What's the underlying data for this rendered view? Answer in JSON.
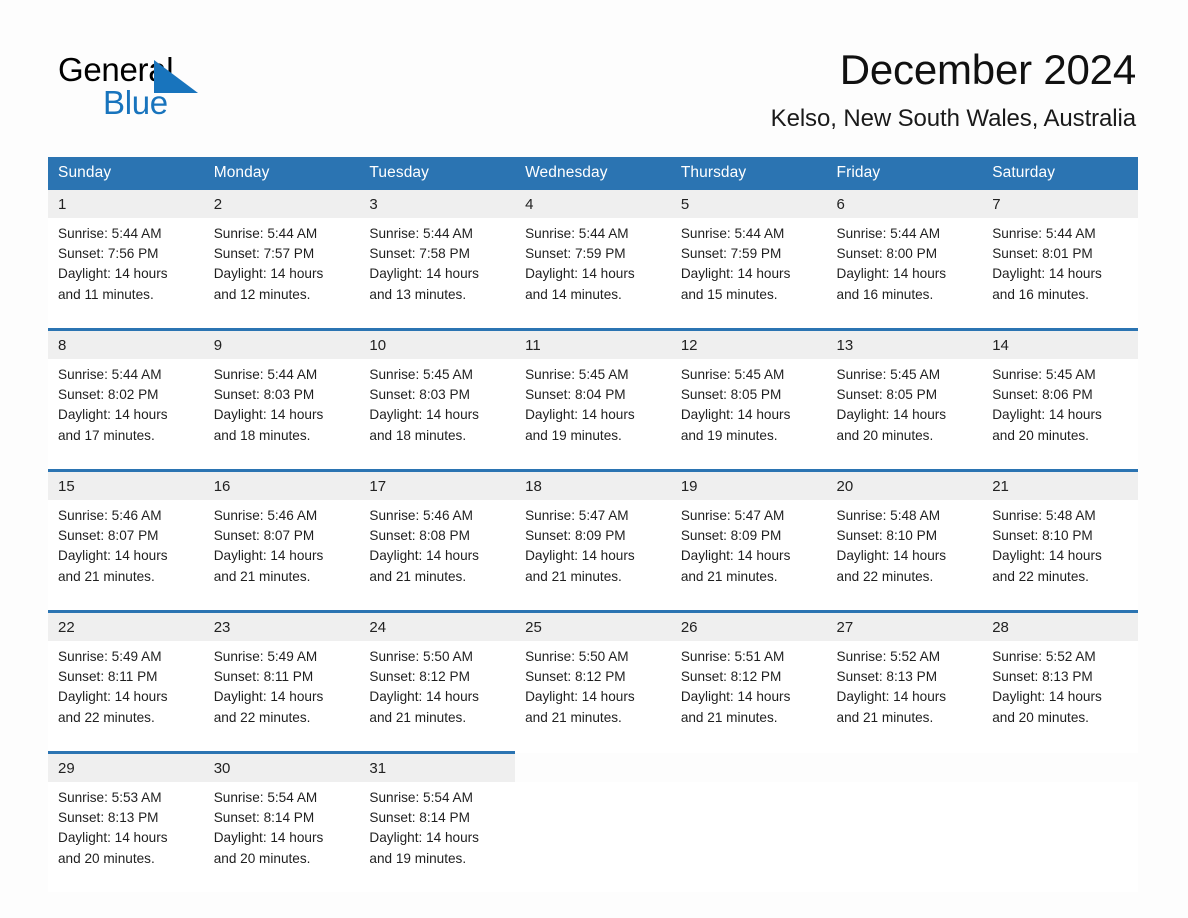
{
  "brand": {
    "name_part1": "General",
    "name_part2": "Blue",
    "triangle_color": "#1874bd"
  },
  "header": {
    "month_title": "December 2024",
    "location": "Kelso, New South Wales, Australia"
  },
  "theme": {
    "header_blue": "#2b74b2",
    "date_band_gray": "#efefef",
    "page_background": "#fdfdfd"
  },
  "weekday_headers": [
    "Sunday",
    "Monday",
    "Tuesday",
    "Wednesday",
    "Thursday",
    "Friday",
    "Saturday"
  ],
  "weeks": [
    {
      "days": [
        {
          "date": "1",
          "sunrise": "Sunrise: 5:44 AM",
          "sunset": "Sunset: 7:56 PM",
          "daylight_line1": "Daylight: 14 hours",
          "daylight_line2": "and 11 minutes."
        },
        {
          "date": "2",
          "sunrise": "Sunrise: 5:44 AM",
          "sunset": "Sunset: 7:57 PM",
          "daylight_line1": "Daylight: 14 hours",
          "daylight_line2": "and 12 minutes."
        },
        {
          "date": "3",
          "sunrise": "Sunrise: 5:44 AM",
          "sunset": "Sunset: 7:58 PM",
          "daylight_line1": "Daylight: 14 hours",
          "daylight_line2": "and 13 minutes."
        },
        {
          "date": "4",
          "sunrise": "Sunrise: 5:44 AM",
          "sunset": "Sunset: 7:59 PM",
          "daylight_line1": "Daylight: 14 hours",
          "daylight_line2": "and 14 minutes."
        },
        {
          "date": "5",
          "sunrise": "Sunrise: 5:44 AM",
          "sunset": "Sunset: 7:59 PM",
          "daylight_line1": "Daylight: 14 hours",
          "daylight_line2": "and 15 minutes."
        },
        {
          "date": "6",
          "sunrise": "Sunrise: 5:44 AM",
          "sunset": "Sunset: 8:00 PM",
          "daylight_line1": "Daylight: 14 hours",
          "daylight_line2": "and 16 minutes."
        },
        {
          "date": "7",
          "sunrise": "Sunrise: 5:44 AM",
          "sunset": "Sunset: 8:01 PM",
          "daylight_line1": "Daylight: 14 hours",
          "daylight_line2": "and 16 minutes."
        }
      ]
    },
    {
      "days": [
        {
          "date": "8",
          "sunrise": "Sunrise: 5:44 AM",
          "sunset": "Sunset: 8:02 PM",
          "daylight_line1": "Daylight: 14 hours",
          "daylight_line2": "and 17 minutes."
        },
        {
          "date": "9",
          "sunrise": "Sunrise: 5:44 AM",
          "sunset": "Sunset: 8:03 PM",
          "daylight_line1": "Daylight: 14 hours",
          "daylight_line2": "and 18 minutes."
        },
        {
          "date": "10",
          "sunrise": "Sunrise: 5:45 AM",
          "sunset": "Sunset: 8:03 PM",
          "daylight_line1": "Daylight: 14 hours",
          "daylight_line2": "and 18 minutes."
        },
        {
          "date": "11",
          "sunrise": "Sunrise: 5:45 AM",
          "sunset": "Sunset: 8:04 PM",
          "daylight_line1": "Daylight: 14 hours",
          "daylight_line2": "and 19 minutes."
        },
        {
          "date": "12",
          "sunrise": "Sunrise: 5:45 AM",
          "sunset": "Sunset: 8:05 PM",
          "daylight_line1": "Daylight: 14 hours",
          "daylight_line2": "and 19 minutes."
        },
        {
          "date": "13",
          "sunrise": "Sunrise: 5:45 AM",
          "sunset": "Sunset: 8:05 PM",
          "daylight_line1": "Daylight: 14 hours",
          "daylight_line2": "and 20 minutes."
        },
        {
          "date": "14",
          "sunrise": "Sunrise: 5:45 AM",
          "sunset": "Sunset: 8:06 PM",
          "daylight_line1": "Daylight: 14 hours",
          "daylight_line2": "and 20 minutes."
        }
      ]
    },
    {
      "days": [
        {
          "date": "15",
          "sunrise": "Sunrise: 5:46 AM",
          "sunset": "Sunset: 8:07 PM",
          "daylight_line1": "Daylight: 14 hours",
          "daylight_line2": "and 21 minutes."
        },
        {
          "date": "16",
          "sunrise": "Sunrise: 5:46 AM",
          "sunset": "Sunset: 8:07 PM",
          "daylight_line1": "Daylight: 14 hours",
          "daylight_line2": "and 21 minutes."
        },
        {
          "date": "17",
          "sunrise": "Sunrise: 5:46 AM",
          "sunset": "Sunset: 8:08 PM",
          "daylight_line1": "Daylight: 14 hours",
          "daylight_line2": "and 21 minutes."
        },
        {
          "date": "18",
          "sunrise": "Sunrise: 5:47 AM",
          "sunset": "Sunset: 8:09 PM",
          "daylight_line1": "Daylight: 14 hours",
          "daylight_line2": "and 21 minutes."
        },
        {
          "date": "19",
          "sunrise": "Sunrise: 5:47 AM",
          "sunset": "Sunset: 8:09 PM",
          "daylight_line1": "Daylight: 14 hours",
          "daylight_line2": "and 21 minutes."
        },
        {
          "date": "20",
          "sunrise": "Sunrise: 5:48 AM",
          "sunset": "Sunset: 8:10 PM",
          "daylight_line1": "Daylight: 14 hours",
          "daylight_line2": "and 22 minutes."
        },
        {
          "date": "21",
          "sunrise": "Sunrise: 5:48 AM",
          "sunset": "Sunset: 8:10 PM",
          "daylight_line1": "Daylight: 14 hours",
          "daylight_line2": "and 22 minutes."
        }
      ]
    },
    {
      "days": [
        {
          "date": "22",
          "sunrise": "Sunrise: 5:49 AM",
          "sunset": "Sunset: 8:11 PM",
          "daylight_line1": "Daylight: 14 hours",
          "daylight_line2": "and 22 minutes."
        },
        {
          "date": "23",
          "sunrise": "Sunrise: 5:49 AM",
          "sunset": "Sunset: 8:11 PM",
          "daylight_line1": "Daylight: 14 hours",
          "daylight_line2": "and 22 minutes."
        },
        {
          "date": "24",
          "sunrise": "Sunrise: 5:50 AM",
          "sunset": "Sunset: 8:12 PM",
          "daylight_line1": "Daylight: 14 hours",
          "daylight_line2": "and 21 minutes."
        },
        {
          "date": "25",
          "sunrise": "Sunrise: 5:50 AM",
          "sunset": "Sunset: 8:12 PM",
          "daylight_line1": "Daylight: 14 hours",
          "daylight_line2": "and 21 minutes."
        },
        {
          "date": "26",
          "sunrise": "Sunrise: 5:51 AM",
          "sunset": "Sunset: 8:12 PM",
          "daylight_line1": "Daylight: 14 hours",
          "daylight_line2": "and 21 minutes."
        },
        {
          "date": "27",
          "sunrise": "Sunrise: 5:52 AM",
          "sunset": "Sunset: 8:13 PM",
          "daylight_line1": "Daylight: 14 hours",
          "daylight_line2": "and 21 minutes."
        },
        {
          "date": "28",
          "sunrise": "Sunrise: 5:52 AM",
          "sunset": "Sunset: 8:13 PM",
          "daylight_line1": "Daylight: 14 hours",
          "daylight_line2": "and 20 minutes."
        }
      ]
    },
    {
      "days": [
        {
          "date": "29",
          "sunrise": "Sunrise: 5:53 AM",
          "sunset": "Sunset: 8:13 PM",
          "daylight_line1": "Daylight: 14 hours",
          "daylight_line2": "and 20 minutes."
        },
        {
          "date": "30",
          "sunrise": "Sunrise: 5:54 AM",
          "sunset": "Sunset: 8:14 PM",
          "daylight_line1": "Daylight: 14 hours",
          "daylight_line2": "and 20 minutes."
        },
        {
          "date": "31",
          "sunrise": "Sunrise: 5:54 AM",
          "sunset": "Sunset: 8:14 PM",
          "daylight_line1": "Daylight: 14 hours",
          "daylight_line2": "and 19 minutes."
        },
        {
          "date": "",
          "sunrise": "",
          "sunset": "",
          "daylight_line1": "",
          "daylight_line2": ""
        },
        {
          "date": "",
          "sunrise": "",
          "sunset": "",
          "daylight_line1": "",
          "daylight_line2": ""
        },
        {
          "date": "",
          "sunrise": "",
          "sunset": "",
          "daylight_line1": "",
          "daylight_line2": ""
        },
        {
          "date": "",
          "sunrise": "",
          "sunset": "",
          "daylight_line1": "",
          "daylight_line2": ""
        }
      ]
    }
  ]
}
